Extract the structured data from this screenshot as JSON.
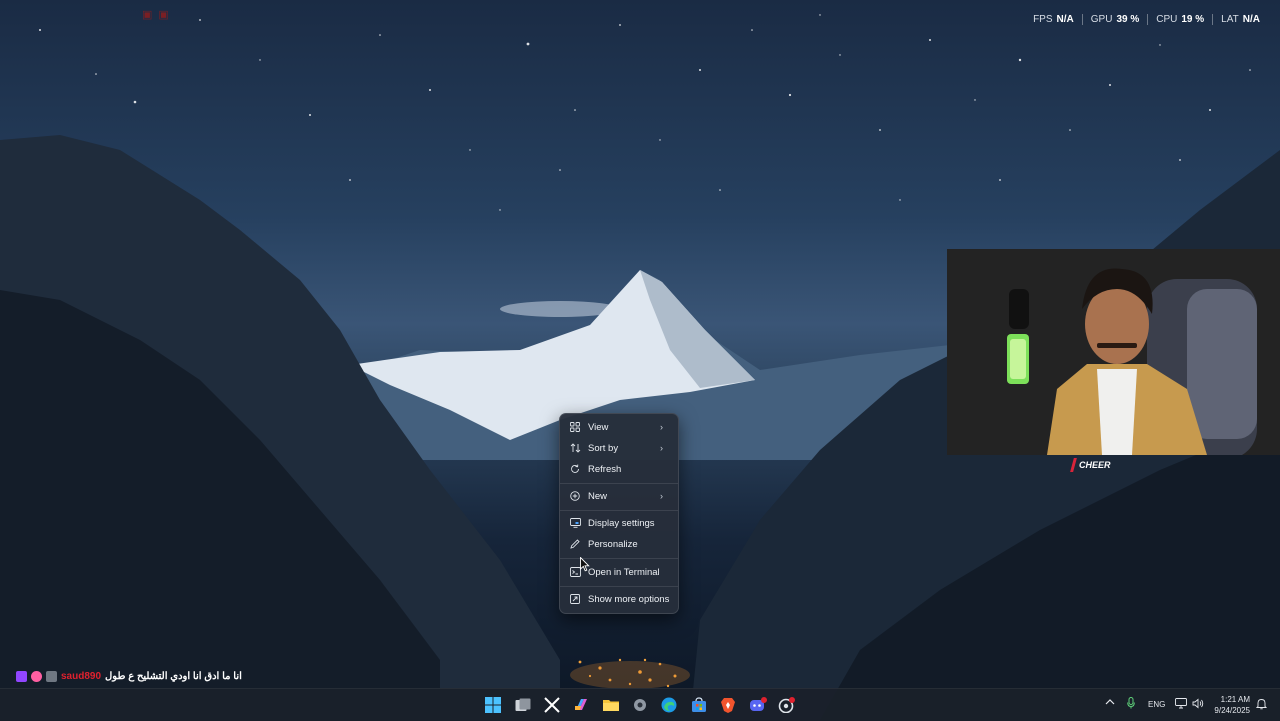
{
  "overlay": {
    "fps_label": "FPS",
    "fps_value": "N/A",
    "gpu_label": "GPU",
    "gpu_value": "39 %",
    "cpu_label": "CPU",
    "cpu_value": "19 %",
    "lat_label": "LAT",
    "lat_value": "N/A"
  },
  "webcam": {
    "cheer_label": "CHEER"
  },
  "context_menu": {
    "items": [
      {
        "label": "View",
        "icon": "grid-view-icon",
        "submenu": true
      },
      {
        "label": "Sort by",
        "icon": "sort-icon",
        "submenu": true
      },
      {
        "label": "Refresh",
        "icon": "refresh-icon",
        "submenu": false
      },
      {
        "label": "New",
        "icon": "new-plus-icon",
        "submenu": true
      },
      {
        "label": "Display settings",
        "icon": "display-icon",
        "submenu": false
      },
      {
        "label": "Personalize",
        "icon": "pen-icon",
        "submenu": false
      },
      {
        "label": "Open in Terminal",
        "icon": "terminal-icon",
        "submenu": false
      },
      {
        "label": "Show more options",
        "icon": "more-options-icon",
        "submenu": false
      }
    ],
    "chevron": "›"
  },
  "chat": {
    "username": "saud890",
    "message": "انا ما ادق انا اودي التشليح ع طول"
  },
  "taskbar": {
    "apps": [
      "windows-start-icon",
      "task-view-icon",
      "x-icon",
      "copilot-icon",
      "file-explorer-icon",
      "settings-icon",
      "edge-icon",
      "store-icon",
      "brave-icon",
      "discord-icon",
      "chrome-icon"
    ],
    "lang": "ENG",
    "time": "1:21 AM",
    "date": "9/24/2025"
  },
  "colors": {
    "menu_bg": "#262e3a",
    "accent_red": "#d8243a",
    "taskbar_bg": "#1a202a"
  }
}
